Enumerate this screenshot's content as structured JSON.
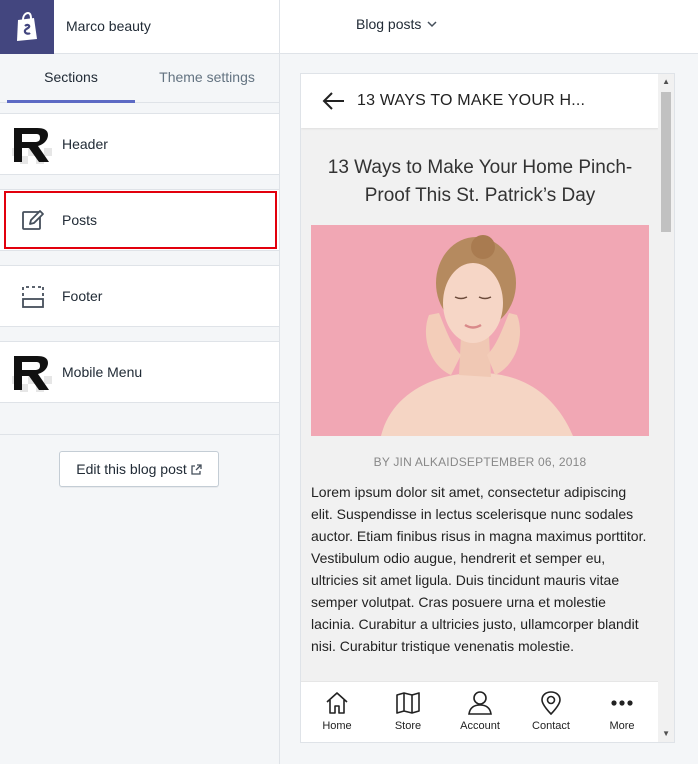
{
  "store": {
    "name": "Marco beauty",
    "logo_icon": "shopify-bag-icon",
    "brand_color": "#43467f"
  },
  "tabs": {
    "sections": "Sections",
    "theme_settings": "Theme settings",
    "active_color": "#5c6ac4"
  },
  "sections": [
    {
      "label": "Header",
      "icon": "r-logo-thumb"
    },
    {
      "label": "Posts",
      "icon": "edit-icon",
      "selected": true
    },
    {
      "label": "Footer",
      "icon": "footer-layout-icon"
    },
    {
      "label": "Mobile Menu",
      "icon": "r-logo-thumb"
    }
  ],
  "edit_button": {
    "label": "Edit this blog post",
    "icon": "external-link-icon"
  },
  "page_selector": {
    "value": "Blog posts"
  },
  "preview": {
    "header_title": "13 WAYS TO MAKE YOUR H...",
    "post_title": "13 Ways to Make Your Home Pinch-Proof This St. Patrick’s Day",
    "byline": "BY JIN ALKAIDSEPTEMBER 06, 2018",
    "body": "Lorem ipsum dolor sit amet, consectetur adipiscing elit. Suspendisse in lectus scelerisque nunc sodales auctor. Etiam finibus risus in magna maximus porttitor. Vestibulum odio augue, hendrerit et semper eu, ultricies sit amet ligula. Duis tincidunt mauris vitae semper volutpat. Cras posuere urna et molestie lacinia. Curabitur a ultricies justo, ullamcorper blandit nisi. Curabitur tristique venenatis molestie.",
    "hero_bg": "#f1a7b4",
    "nav": [
      {
        "label": "Home",
        "icon": "home-icon"
      },
      {
        "label": "Store",
        "icon": "map-icon"
      },
      {
        "label": "Account",
        "icon": "user-icon"
      },
      {
        "label": "Contact",
        "icon": "location-pin-icon"
      },
      {
        "label": "More",
        "icon": "more-dots-icon"
      }
    ]
  },
  "highlight_color": "#e2000d"
}
